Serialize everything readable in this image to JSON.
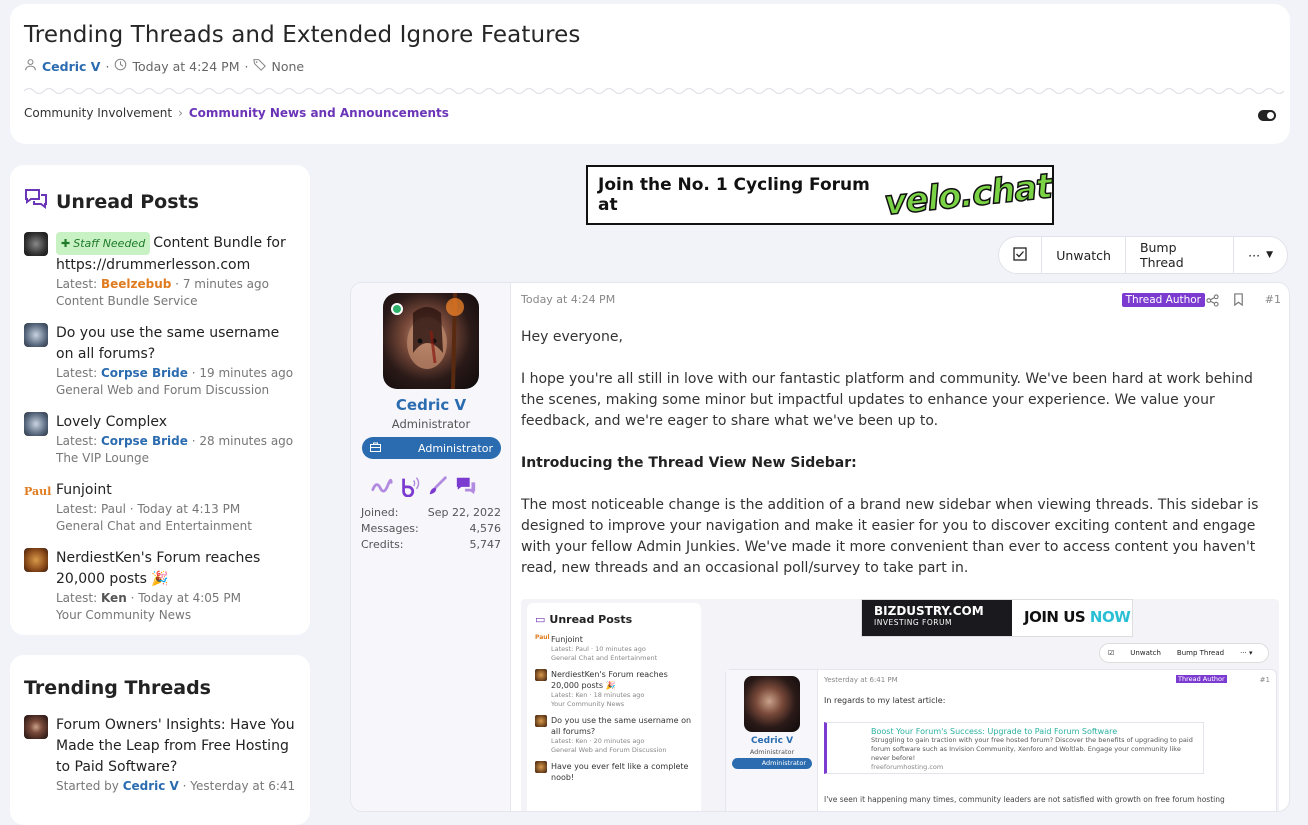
{
  "thread": {
    "title": "Trending Threads and Extended Ignore Features",
    "author": "Cedric V",
    "time": "Today at 4:24 PM",
    "tags": "None"
  },
  "breadcrumb": {
    "parent": "Community Involvement",
    "current": "Community News and Announcements"
  },
  "unread": {
    "title": "Unread Posts",
    "items": [
      {
        "badge": "Staff Needed",
        "topic": "Content Bundle for https://drummerlesson.com",
        "latest_label": "Latest:",
        "user": "Beelzebub",
        "time": "7 minutes ago",
        "forum": "Content Bundle Service"
      },
      {
        "topic": "Do you use the same username on all forums?",
        "latest_label": "Latest:",
        "user": "Corpse Bride",
        "time": "19 minutes ago",
        "forum": "General Web and Forum Discussion"
      },
      {
        "topic": "Lovely Complex",
        "latest_label": "Latest:",
        "user": "Corpse Bride",
        "time": "28 minutes ago",
        "forum": "The VIP Lounge"
      },
      {
        "topic": "Funjoint",
        "latest_label": "Latest:",
        "user": "Paul",
        "time": "Today at 4:13 PM",
        "forum": "General Chat and Entertainment"
      },
      {
        "topic": "NerdiestKen's Forum reaches 20,000 posts 🎉",
        "latest_label": "Latest:",
        "user": "Ken",
        "time": "Today at 4:05 PM",
        "forum": "Your Community News"
      }
    ]
  },
  "trending": {
    "title": "Trending Threads",
    "items": [
      {
        "topic": "Forum Owners' Insights: Have You Made the Leap from Free Hosting to Paid Software?",
        "started_label": "Started by",
        "user": "Cedric V",
        "time": "Yesterday at 6:41"
      }
    ]
  },
  "banner": {
    "text": "Join the No. 1 Cycling Forum at",
    "logo": "velo.chat"
  },
  "actions": {
    "unwatch": "Unwatch",
    "bump": "Bump Thread",
    "more": "···"
  },
  "post": {
    "time": "Today at 4:24 PM",
    "author_tag": "Thread Author",
    "number": "#1",
    "user": {
      "name": "Cedric V",
      "title": "Administrator",
      "banner": "Administrator",
      "joined_label": "Joined:",
      "joined": "Sep 22, 2022",
      "messages_label": "Messages:",
      "messages": "4,576",
      "credits_label": "Credits:",
      "credits": "5,747"
    },
    "greeting": "Hey everyone,",
    "p1": "I hope you're all still in love with our fantastic platform and community. We've been hard at work behind the scenes, making some minor but impactful updates to enhance your experience. We value your feedback, and we're eager to share what we've been up to.",
    "heading": "Introducing the Thread View New Sidebar:",
    "p2": "The most noticeable change is the addition of a brand new sidebar when viewing threads. This sidebar is designed to improve your navigation and make it easier for you to discover exciting content and engage with your fellow Admin Junkies. We've made it more convenient than ever to access content you haven't read, new threads and an occasional poll/survey to take part in."
  },
  "screenshot": {
    "side_title": "Unread Posts",
    "items": [
      {
        "topic": "Funjoint",
        "latest": "Latest: Paul · 10 minutes ago",
        "forum": "General Chat and Entertainment"
      },
      {
        "topic": "NerdiestKen's Forum reaches 20,000 posts 🎉",
        "latest": "Latest: Ken · 18 minutes ago",
        "forum": "Your Community News"
      },
      {
        "topic": "Do you use the same username on all forums?",
        "latest": "Latest: Ken · 20 minutes ago",
        "forum": "General Web and Forum Discussion"
      },
      {
        "topic": "Have you ever felt like a complete noob!",
        "latest": "",
        "forum": ""
      }
    ],
    "banner_l1": "BIZDUSTRY.COM",
    "banner_l2": "INVESTING FORUM",
    "banner_join": "JOIN US",
    "banner_now": "NOW",
    "unwatch": "Unwatch",
    "bump": "Bump Thread",
    "time": "Yesterday at 6:41 PM",
    "tag": "Thread Author",
    "num": "#1",
    "name": "Cedric V",
    "title": "Administrator",
    "ubanner": "Administrator",
    "text": "In regards to my latest article:",
    "link_title": "Boost Your Forum's Success: Upgrade to Paid Forum Software",
    "link_desc": "Struggling to gain traction with your free hosted forum? Discover the benefits of upgrading to paid forum software such as Invision Community, Xenforo and Woltlab. Engage your community like never before!",
    "link_url": "freeforumhosting.com",
    "bottom": "I've seen it happening many times, community leaders are not satisfied with growth on free forum hosting"
  }
}
